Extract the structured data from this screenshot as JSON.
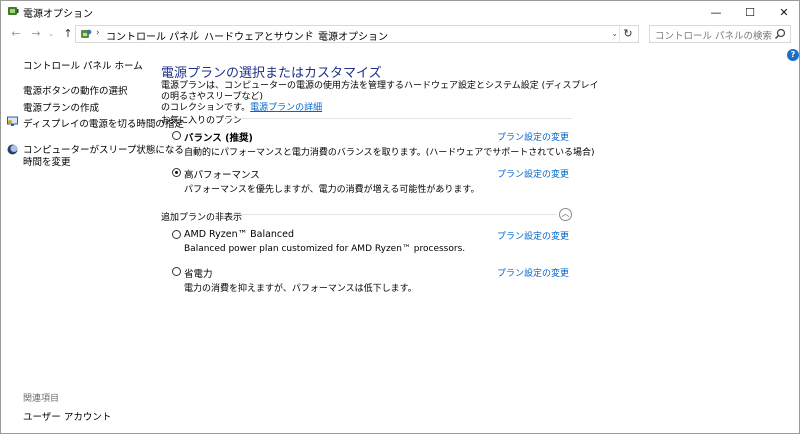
{
  "window": {
    "title": "電源オプション",
    "controls": {
      "minimize": "—",
      "maximize": "☐",
      "close": "✕"
    }
  },
  "address_bar": {
    "crumbs": [
      "コントロール パネル",
      "ハードウェアとサウンド",
      "電源オプション"
    ],
    "search_placeholder": "コントロール パネルの検索"
  },
  "sidebar": {
    "home": "コントロール パネル ホーム",
    "items": [
      {
        "label": "電源ボタンの動作の選択"
      },
      {
        "label": "電源プランの作成"
      },
      {
        "label": "ディスプレイの電源を切る時間の指定"
      },
      {
        "label": "コンピューターがスリープ状態になる",
        "label2": "時間を変更"
      }
    ],
    "related_heading": "関連項目",
    "related": [
      "ユーザー アカウント"
    ]
  },
  "main": {
    "title": "電源プランの選択またはカスタマイズ",
    "description_line1": "電源プランは、コンピューターの電源の使用方法を管理するハードウェア設定とシステム設定 (ディスプレイの明るさやスリープなど)",
    "description_line2": "のコレクションです。",
    "description_link": "電源プランの詳細",
    "favorites_heading": "お気に入りのプラン",
    "hidden_heading": "追加プランの非表示",
    "change_label": "プラン設定の変更",
    "plans": [
      {
        "name": "バランス (推奨)",
        "desc": "自動的にパフォーマンスと電力消費のバランスを取ります。(ハードウェアでサポートされている場合)",
        "selected": false
      },
      {
        "name": "高パフォーマンス",
        "desc": "パフォーマンスを優先しますが、電力の消費が増える可能性があります。",
        "selected": true
      },
      {
        "name": "AMD Ryzen™ Balanced",
        "desc": "Balanced power plan customized for AMD Ryzen™ processors.",
        "selected": false
      },
      {
        "name": "省電力",
        "desc": "電力の消費を抑えますが、パフォーマンスは低下します。",
        "selected": false
      }
    ]
  }
}
